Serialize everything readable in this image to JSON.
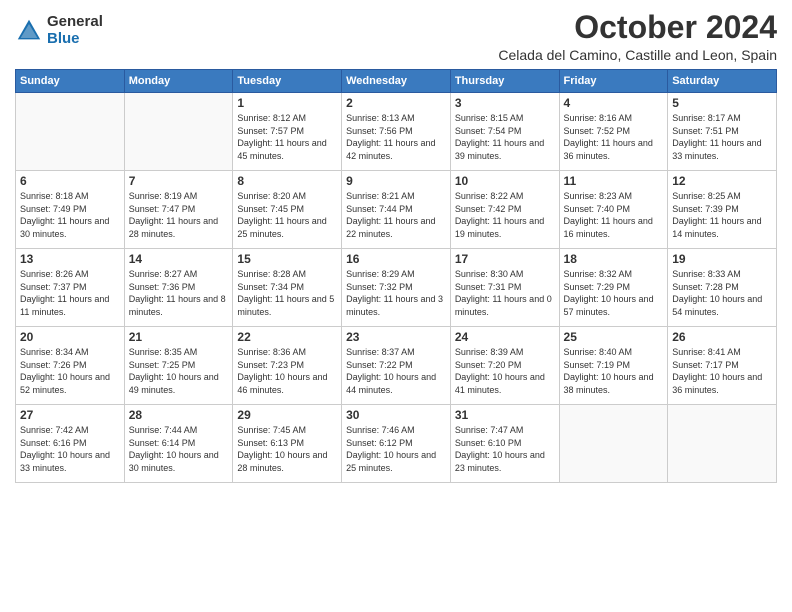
{
  "logo": {
    "general": "General",
    "blue": "Blue"
  },
  "title": "October 2024",
  "subtitle": "Celada del Camino, Castille and Leon, Spain",
  "headers": [
    "Sunday",
    "Monday",
    "Tuesday",
    "Wednesday",
    "Thursday",
    "Friday",
    "Saturday"
  ],
  "weeks": [
    [
      {
        "day": "",
        "info": ""
      },
      {
        "day": "",
        "info": ""
      },
      {
        "day": "1",
        "info": "Sunrise: 8:12 AM\nSunset: 7:57 PM\nDaylight: 11 hours and 45 minutes."
      },
      {
        "day": "2",
        "info": "Sunrise: 8:13 AM\nSunset: 7:56 PM\nDaylight: 11 hours and 42 minutes."
      },
      {
        "day": "3",
        "info": "Sunrise: 8:15 AM\nSunset: 7:54 PM\nDaylight: 11 hours and 39 minutes."
      },
      {
        "day": "4",
        "info": "Sunrise: 8:16 AM\nSunset: 7:52 PM\nDaylight: 11 hours and 36 minutes."
      },
      {
        "day": "5",
        "info": "Sunrise: 8:17 AM\nSunset: 7:51 PM\nDaylight: 11 hours and 33 minutes."
      }
    ],
    [
      {
        "day": "6",
        "info": "Sunrise: 8:18 AM\nSunset: 7:49 PM\nDaylight: 11 hours and 30 minutes."
      },
      {
        "day": "7",
        "info": "Sunrise: 8:19 AM\nSunset: 7:47 PM\nDaylight: 11 hours and 28 minutes."
      },
      {
        "day": "8",
        "info": "Sunrise: 8:20 AM\nSunset: 7:45 PM\nDaylight: 11 hours and 25 minutes."
      },
      {
        "day": "9",
        "info": "Sunrise: 8:21 AM\nSunset: 7:44 PM\nDaylight: 11 hours and 22 minutes."
      },
      {
        "day": "10",
        "info": "Sunrise: 8:22 AM\nSunset: 7:42 PM\nDaylight: 11 hours and 19 minutes."
      },
      {
        "day": "11",
        "info": "Sunrise: 8:23 AM\nSunset: 7:40 PM\nDaylight: 11 hours and 16 minutes."
      },
      {
        "day": "12",
        "info": "Sunrise: 8:25 AM\nSunset: 7:39 PM\nDaylight: 11 hours and 14 minutes."
      }
    ],
    [
      {
        "day": "13",
        "info": "Sunrise: 8:26 AM\nSunset: 7:37 PM\nDaylight: 11 hours and 11 minutes."
      },
      {
        "day": "14",
        "info": "Sunrise: 8:27 AM\nSunset: 7:36 PM\nDaylight: 11 hours and 8 minutes."
      },
      {
        "day": "15",
        "info": "Sunrise: 8:28 AM\nSunset: 7:34 PM\nDaylight: 11 hours and 5 minutes."
      },
      {
        "day": "16",
        "info": "Sunrise: 8:29 AM\nSunset: 7:32 PM\nDaylight: 11 hours and 3 minutes."
      },
      {
        "day": "17",
        "info": "Sunrise: 8:30 AM\nSunset: 7:31 PM\nDaylight: 11 hours and 0 minutes."
      },
      {
        "day": "18",
        "info": "Sunrise: 8:32 AM\nSunset: 7:29 PM\nDaylight: 10 hours and 57 minutes."
      },
      {
        "day": "19",
        "info": "Sunrise: 8:33 AM\nSunset: 7:28 PM\nDaylight: 10 hours and 54 minutes."
      }
    ],
    [
      {
        "day": "20",
        "info": "Sunrise: 8:34 AM\nSunset: 7:26 PM\nDaylight: 10 hours and 52 minutes."
      },
      {
        "day": "21",
        "info": "Sunrise: 8:35 AM\nSunset: 7:25 PM\nDaylight: 10 hours and 49 minutes."
      },
      {
        "day": "22",
        "info": "Sunrise: 8:36 AM\nSunset: 7:23 PM\nDaylight: 10 hours and 46 minutes."
      },
      {
        "day": "23",
        "info": "Sunrise: 8:37 AM\nSunset: 7:22 PM\nDaylight: 10 hours and 44 minutes."
      },
      {
        "day": "24",
        "info": "Sunrise: 8:39 AM\nSunset: 7:20 PM\nDaylight: 10 hours and 41 minutes."
      },
      {
        "day": "25",
        "info": "Sunrise: 8:40 AM\nSunset: 7:19 PM\nDaylight: 10 hours and 38 minutes."
      },
      {
        "day": "26",
        "info": "Sunrise: 8:41 AM\nSunset: 7:17 PM\nDaylight: 10 hours and 36 minutes."
      }
    ],
    [
      {
        "day": "27",
        "info": "Sunrise: 7:42 AM\nSunset: 6:16 PM\nDaylight: 10 hours and 33 minutes."
      },
      {
        "day": "28",
        "info": "Sunrise: 7:44 AM\nSunset: 6:14 PM\nDaylight: 10 hours and 30 minutes."
      },
      {
        "day": "29",
        "info": "Sunrise: 7:45 AM\nSunset: 6:13 PM\nDaylight: 10 hours and 28 minutes."
      },
      {
        "day": "30",
        "info": "Sunrise: 7:46 AM\nSunset: 6:12 PM\nDaylight: 10 hours and 25 minutes."
      },
      {
        "day": "31",
        "info": "Sunrise: 7:47 AM\nSunset: 6:10 PM\nDaylight: 10 hours and 23 minutes."
      },
      {
        "day": "",
        "info": ""
      },
      {
        "day": "",
        "info": ""
      }
    ]
  ]
}
